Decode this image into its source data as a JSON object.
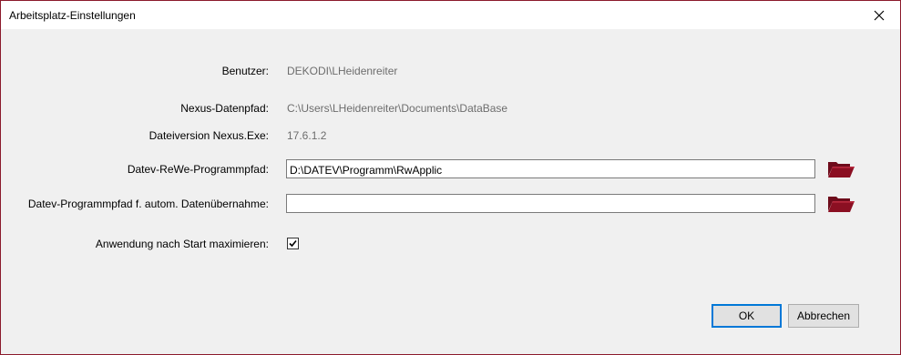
{
  "window": {
    "title": "Arbeitsplatz-Einstellungen",
    "close_icon": "close-icon"
  },
  "fields": {
    "benutzer": {
      "label": "Benutzer:",
      "value": "DEKODI\\LHeidenreiter"
    },
    "nexus_datenpfad": {
      "label": "Nexus-Datenpfad:",
      "value": "C:\\Users\\LHeidenreiter\\Documents\\DataBase"
    },
    "dateiversion": {
      "label": "Dateiversion Nexus.Exe:",
      "value": "17.6.1.2"
    },
    "datev_rewe": {
      "label": "Datev-ReWe-Programmpfad:",
      "value": "D:\\DATEV\\Programm\\RwApplic",
      "icon": "folder-open-icon"
    },
    "datev_autom": {
      "label": "Datev-Programmpfad f. autom. Datenübernahme:",
      "value": "",
      "icon": "folder-open-icon"
    },
    "maximize": {
      "label": "Anwendung nach Start maximieren:",
      "checked": true
    }
  },
  "buttons": {
    "ok": "OK",
    "cancel": "Abbrechen"
  },
  "colors": {
    "border": "#8b1a2b",
    "folder": "#8b0f22",
    "default_button_border": "#0078d7"
  }
}
